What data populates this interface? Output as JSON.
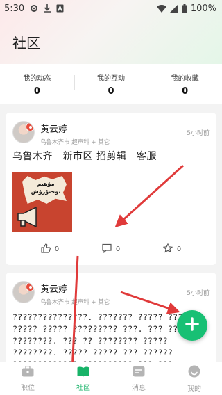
{
  "status_bar": {
    "time": "5:30",
    "battery": "100%"
  },
  "header": {
    "title": "社区"
  },
  "stats": [
    {
      "label": "我的动态",
      "value": "0"
    },
    {
      "label": "我的互动",
      "value": "0"
    },
    {
      "label": "我的收藏",
      "value": "0"
    }
  ],
  "posts": [
    {
      "author": "黄云婷",
      "meta": "乌鲁木齐市 超声科 + 其它",
      "time": "5小时前",
      "text": "乌鲁木齐　新市区 招剪辑　客服",
      "image_caption": "مۇھىم توختۇرۇش",
      "likes": "0",
      "comments": "0",
      "favorites": "0"
    },
    {
      "author": "黄云婷",
      "meta": "乌鲁木齐市 超声科 + 其它",
      "time": "5小时前",
      "body": "???????????????. ??????? ????? ????? ????? ????? ????????? ???. ??? ???????? ????????. ??? ?? ???????? ????? ????????. ????? ????? ??? ?????? ????????????? ?????????? ??? ???"
    }
  ],
  "fab": {
    "icon": "plus-icon"
  },
  "tabbar": {
    "items": [
      {
        "label": "职位",
        "icon": "briefcase-icon"
      },
      {
        "label": "社区",
        "icon": "book-icon"
      },
      {
        "label": "消息",
        "icon": "message-icon"
      },
      {
        "label": "我的",
        "icon": "profile-icon"
      }
    ],
    "active_index": 1
  },
  "colors": {
    "accent": "#18c074",
    "annotation_arrow": "#e03a3a"
  }
}
